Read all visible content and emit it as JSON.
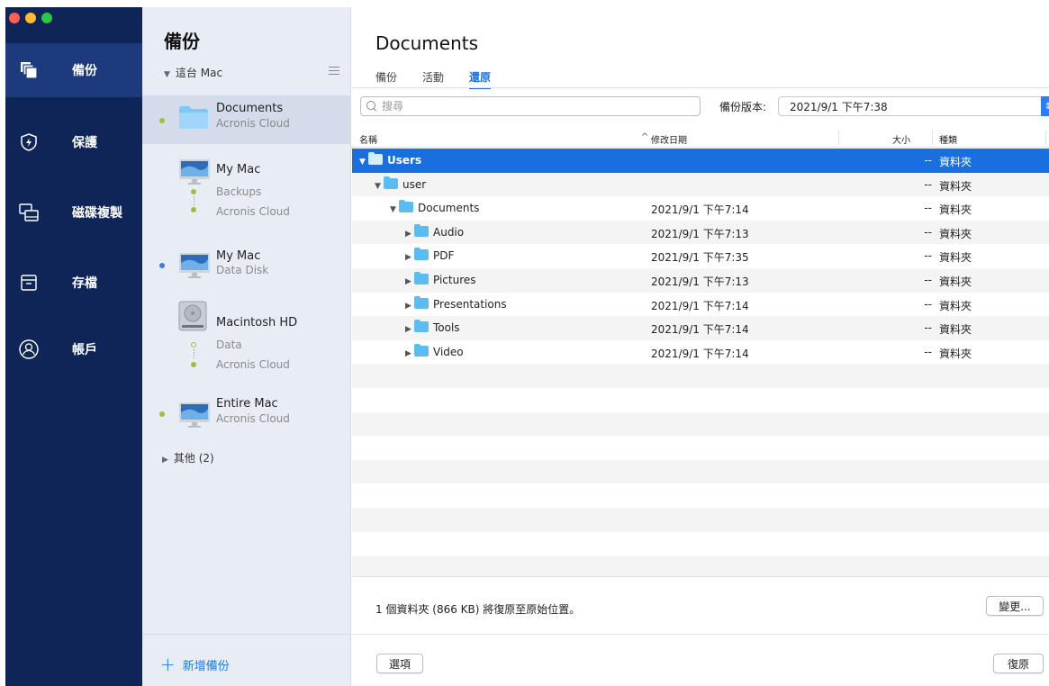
{
  "colors": {
    "nav_bg": "#0f2557",
    "nav_active": "#1c3a7c",
    "accent": "#1f6fd8",
    "selection": "#1a6fe0",
    "status_green": "#9ac13b",
    "status_blue": "#3b82d4"
  },
  "window_controls": {
    "close": "#ff5f57",
    "minimize": "#febc2e",
    "zoom": "#28c840"
  },
  "nav": [
    {
      "label": "備份",
      "icon": "backup-icon",
      "active": true
    },
    {
      "label": "保護",
      "icon": "shield-icon",
      "active": false
    },
    {
      "label": "磁碟複製",
      "icon": "disk-clone-icon",
      "active": false
    },
    {
      "label": "存檔",
      "icon": "archive-icon",
      "active": false
    },
    {
      "label": "帳戶",
      "icon": "account-icon",
      "active": false
    }
  ],
  "list": {
    "title": "備份",
    "group": "這台 Mac",
    "entries": [
      {
        "title": "Documents",
        "sub": [
          "Acronis Cloud"
        ]
      },
      {
        "title": "My Mac",
        "sub": [
          "Backups",
          "Acronis Cloud"
        ]
      },
      {
        "title": "My Mac",
        "sub": [
          "Data Disk"
        ]
      },
      {
        "title": "Macintosh HD",
        "sub": [
          "Data",
          "Acronis Cloud"
        ]
      },
      {
        "title": "Entire Mac",
        "sub": [
          "Acronis Cloud"
        ]
      }
    ],
    "others": "其他 (2)",
    "add": "新增備份"
  },
  "main": {
    "title": "Documents",
    "tabs": [
      "備份",
      "活動",
      "還原"
    ],
    "active_tab": "還原",
    "search_placeholder": "搜尋",
    "version_label": "備份版本:",
    "version_value": "2021/9/1 下午7:38",
    "columns": {
      "name": "名稱",
      "date": "修改日期",
      "size": "大小",
      "kind": "種類"
    },
    "rows": [
      {
        "name": "Users",
        "date": "",
        "size": "--",
        "kind": "資料夾"
      },
      {
        "name": "user",
        "date": "",
        "size": "--",
        "kind": "資料夾"
      },
      {
        "name": "Documents",
        "date": "2021/9/1 下午7:14",
        "size": "--",
        "kind": "資料夾"
      },
      {
        "name": "Audio",
        "date": "2021/9/1 下午7:13",
        "size": "--",
        "kind": "資料夾"
      },
      {
        "name": "PDF",
        "date": "2021/9/1 下午7:35",
        "size": "--",
        "kind": "資料夾"
      },
      {
        "name": "Pictures",
        "date": "2021/9/1 下午7:13",
        "size": "--",
        "kind": "資料夾"
      },
      {
        "name": "Presentations",
        "date": "2021/9/1 下午7:14",
        "size": "--",
        "kind": "資料夾"
      },
      {
        "name": "Tools",
        "date": "2021/9/1 下午7:14",
        "size": "--",
        "kind": "資料夾"
      },
      {
        "name": "Video",
        "date": "2021/9/1 下午7:14",
        "size": "--",
        "kind": "資料夾"
      }
    ],
    "summary": "1 個資料夾 (866 KB) 將復原至原始位置。",
    "change_button": "變更...",
    "options_button": "選項",
    "restore_button": "復原"
  }
}
